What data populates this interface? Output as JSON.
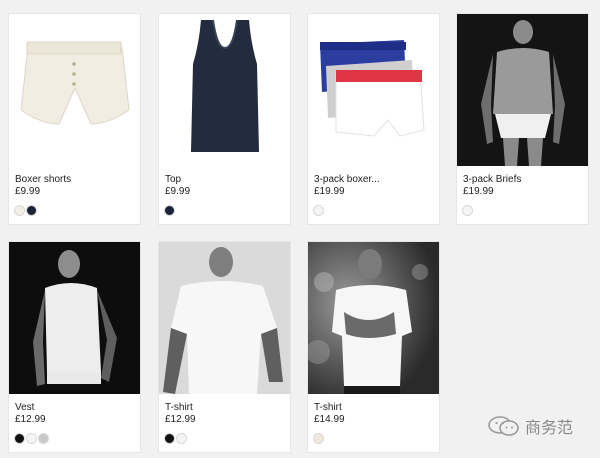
{
  "products": [
    {
      "name": "Boxer shorts",
      "price": "£9.99",
      "swatches": [
        "#f3eee3",
        "#1b2337"
      ]
    },
    {
      "name": "Top",
      "price": "£9.99",
      "swatches": [
        "#1b2337"
      ]
    },
    {
      "name": "3-pack boxer...",
      "price": "£19.99",
      "swatches": [
        "#f4f4f4"
      ]
    },
    {
      "name": "3-pack Briefs",
      "price": "£19.99",
      "swatches": [
        "#f4f4f4"
      ]
    },
    {
      "name": "Vest",
      "price": "£12.99",
      "swatches": [
        "#111111",
        "#f4f4f4",
        "#c9c9c9"
      ]
    },
    {
      "name": "T-shirt",
      "price": "£12.99",
      "swatches": [
        "#111111",
        "#f4f4f4"
      ]
    },
    {
      "name": "T-shirt",
      "price": "£14.99",
      "swatches": [
        "#efe8dc"
      ]
    }
  ],
  "watermark": {
    "text": "商务范",
    "icon": "wechat-icon"
  }
}
